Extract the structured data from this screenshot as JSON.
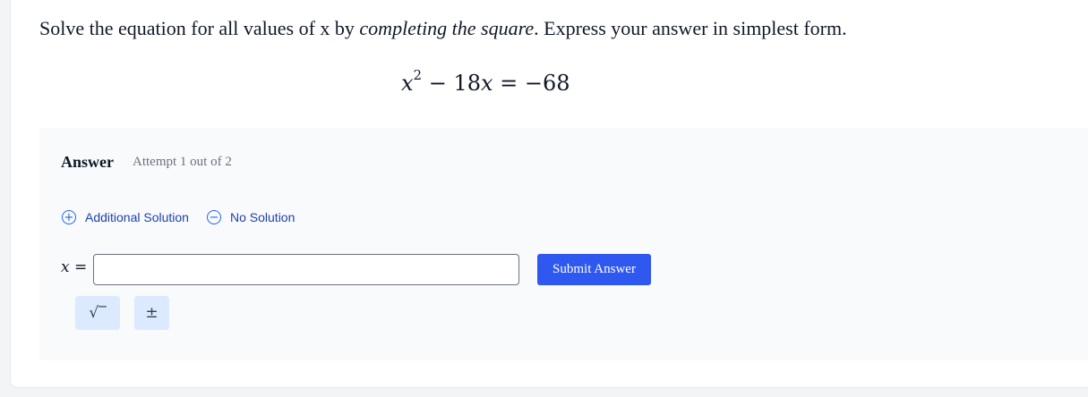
{
  "question": {
    "text_before": "Solve the equation for all values of x by ",
    "text_emphasis": "completing the square",
    "text_after": ". Express your answer in simplest form.",
    "equation": {
      "base": "x",
      "exponent": "2",
      "middle": " − 18",
      "middle_var": "x",
      "rhs": " = −68"
    }
  },
  "answer": {
    "title": "Answer",
    "attempt": "Attempt 1 out of 2",
    "additional_solution": "Additional Solution",
    "no_solution": "No Solution",
    "variable": "x",
    "equals": " =",
    "input_value": "",
    "submit_label": "Submit Answer",
    "tools": {
      "sqrt_symbol": "√‾",
      "plusminus_symbol": "±"
    }
  },
  "icons": {
    "plus_circle": "plus-circle-icon",
    "minus_circle": "minus-circle-icon"
  },
  "colors": {
    "accent": "#2f58f0",
    "link": "#1e40af",
    "panel": "#f8fafc",
    "tool_bg": "#dbeafe"
  }
}
